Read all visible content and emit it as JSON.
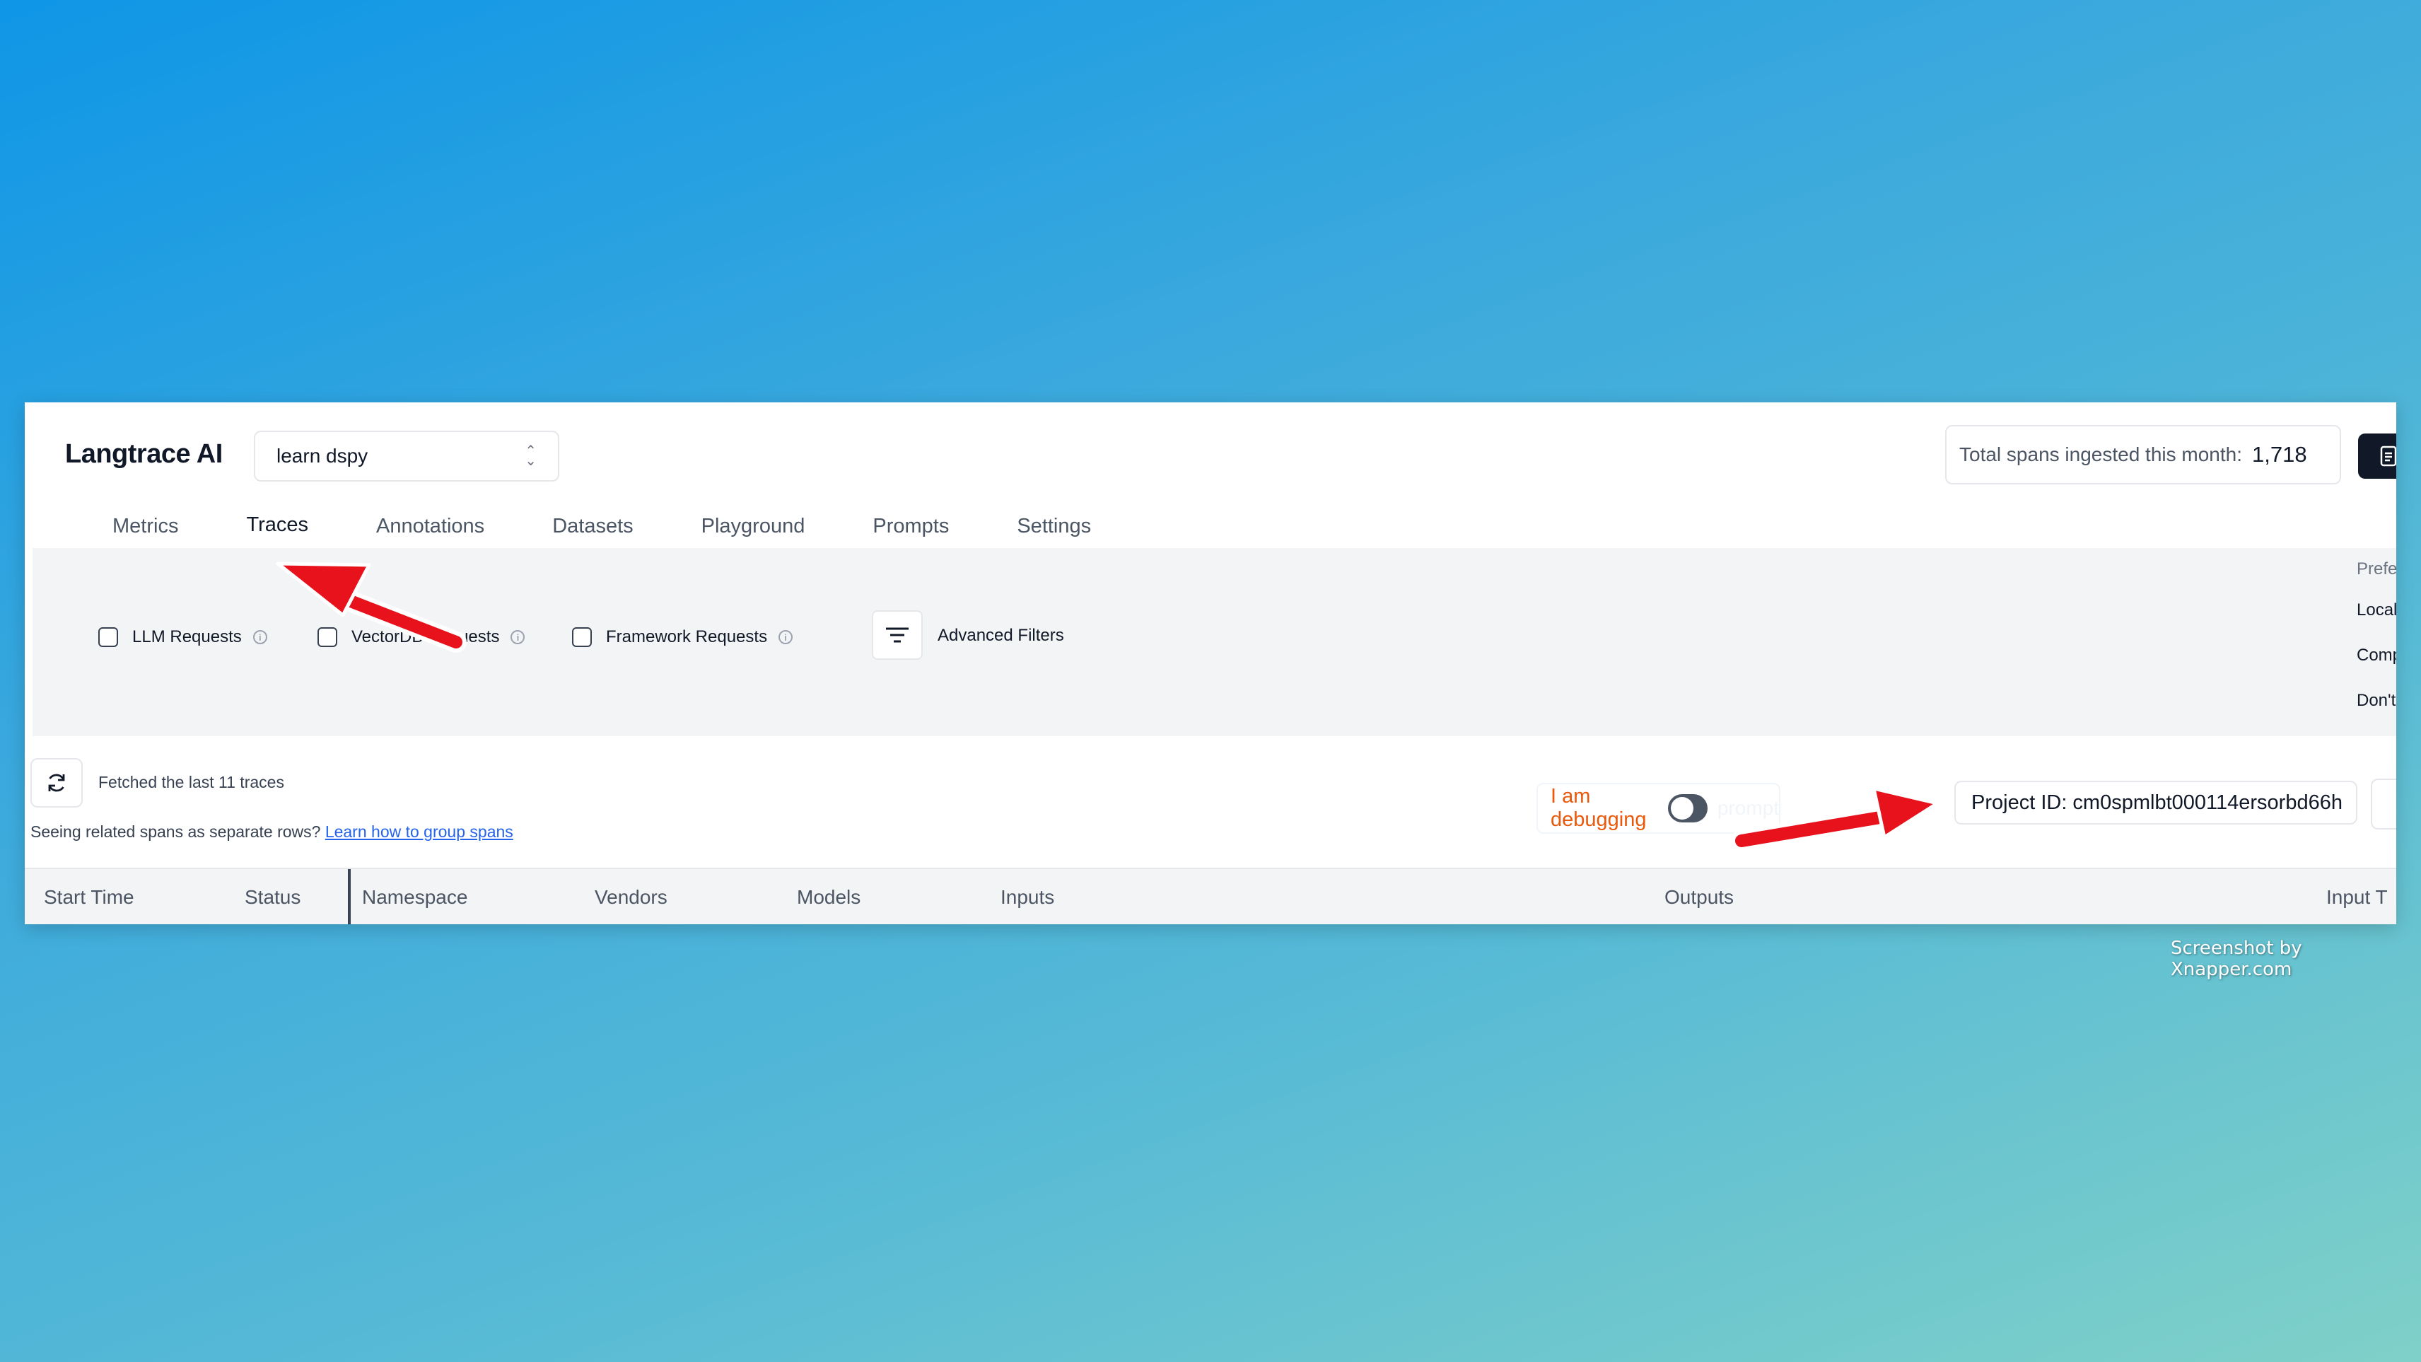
{
  "app": {
    "brand": "Langtrace AI",
    "project_selector": {
      "value": "learn dspy"
    },
    "spans_counter": {
      "label": "Total spans ingested this month:",
      "value": "1,718"
    }
  },
  "tabs": [
    {
      "label": "Metrics",
      "active": false
    },
    {
      "label": "Traces",
      "active": true
    },
    {
      "label": "Annotations",
      "active": false
    },
    {
      "label": "Datasets",
      "active": false
    },
    {
      "label": "Playground",
      "active": false
    },
    {
      "label": "Prompts",
      "active": false
    },
    {
      "label": "Settings",
      "active": false
    }
  ],
  "filters": {
    "llm": "LLM Requests",
    "vectordb": "VectorDB Requests",
    "framework": "Framework Requests",
    "advanced": "Advanced Filters"
  },
  "preferences": {
    "heading": "Prefe",
    "options": [
      "Local",
      "Comp",
      "Don't"
    ]
  },
  "traces": {
    "fetched": "Fetched the last 11 traces",
    "seeing_text": "Seeing related spans as separate rows?",
    "learn_link": "Learn how to group spans",
    "debug_label": "I am debugging",
    "debug_faint": "prompt"
  },
  "project_id": "Project ID: cm0spmlbt000114ersorbd66h",
  "table": {
    "columns": [
      "Start Time",
      "Status",
      "Namespace",
      "Vendors",
      "Models",
      "Inputs",
      "Outputs",
      "Input T"
    ]
  },
  "annotation_color": "#e8121c",
  "watermark": "Screenshot by Xnapper.com"
}
